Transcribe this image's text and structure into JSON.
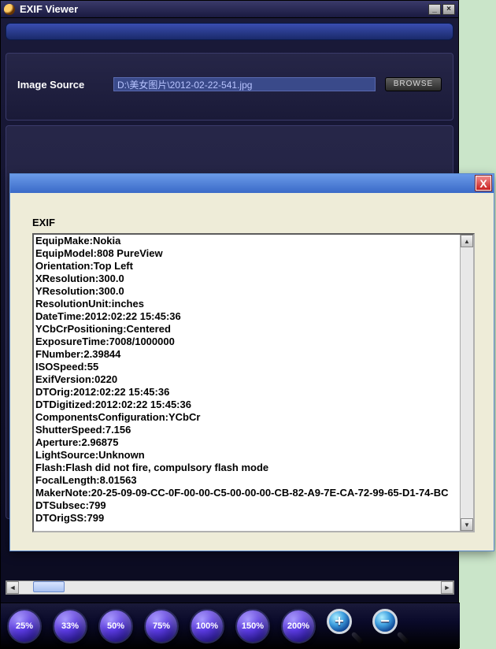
{
  "window": {
    "title": "EXIF Viewer",
    "minimize": "_",
    "close": "×"
  },
  "source": {
    "label": "Image Source",
    "path": "D:\\美女图片\\2012-02-22-541.jpg",
    "browse": "BROWSE"
  },
  "popup": {
    "label": "EXIF",
    "close": "X",
    "lines": [
      "EquipMake:Nokia",
      "EquipModel:808 PureView",
      "Orientation:Top Left",
      "XResolution:300.0",
      "YResolution:300.0",
      "ResolutionUnit:inches",
      "DateTime:2012:02:22 15:45:36",
      "YCbCrPositioning:Centered",
      "ExposureTime:7008/1000000",
      "FNumber:2.39844",
      "ISOSpeed:55",
      "ExifVersion:0220",
      "DTOrig:2012:02:22 15:45:36",
      "DTDigitized:2012:02:22 15:45:36",
      "ComponentsConfiguration:YCbCr",
      "ShutterSpeed:7.156",
      "Aperture:2.96875",
      "LightSource:Unknown",
      "Flash:Flash did not fire, compulsory flash mode",
      "FocalLength:8.01563",
      "MakerNote:20-25-09-09-CC-0F-00-00-C5-00-00-00-CB-82-A9-7E-CA-72-99-65-D1-74-BC",
      "DTSubsec:799",
      "DTOrigSS:799"
    ]
  },
  "zoom": {
    "levels": [
      "25%",
      "33%",
      "50%",
      "75%",
      "100%",
      "150%",
      "200%"
    ],
    "plus": "+",
    "minus": "−"
  }
}
